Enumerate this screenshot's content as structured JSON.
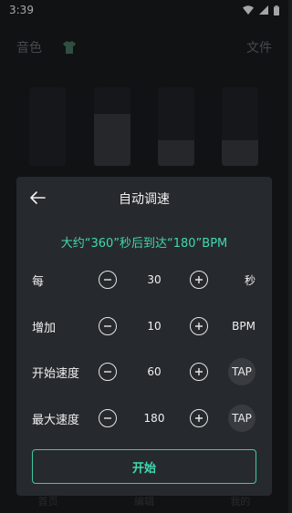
{
  "status": {
    "time": "3:39"
  },
  "topbar": {
    "left_label": "音色",
    "right_label": "文件",
    "icon": "shirt-icon"
  },
  "bars": {
    "levels": [
      0,
      0.66,
      0.33,
      0.33
    ]
  },
  "bottom_nav": {
    "items": [
      "首页",
      "编辑",
      "我的"
    ]
  },
  "dialog": {
    "title": "自动调速",
    "summary": "大约“360”秒后到达“180”BPM",
    "rows": [
      {
        "label": "每",
        "value": "30",
        "unit": "秒"
      },
      {
        "label": "增加",
        "value": "10",
        "unit": "BPM"
      },
      {
        "label": "开始速度",
        "value": "60",
        "tap": "TAP"
      },
      {
        "label": "最大速度",
        "value": "180",
        "tap": "TAP"
      }
    ],
    "start_label": "开始"
  },
  "colors": {
    "accent": "#3fd9b0",
    "dialog_bg": "#262a2e",
    "page_bg": "#1a1c1f"
  }
}
